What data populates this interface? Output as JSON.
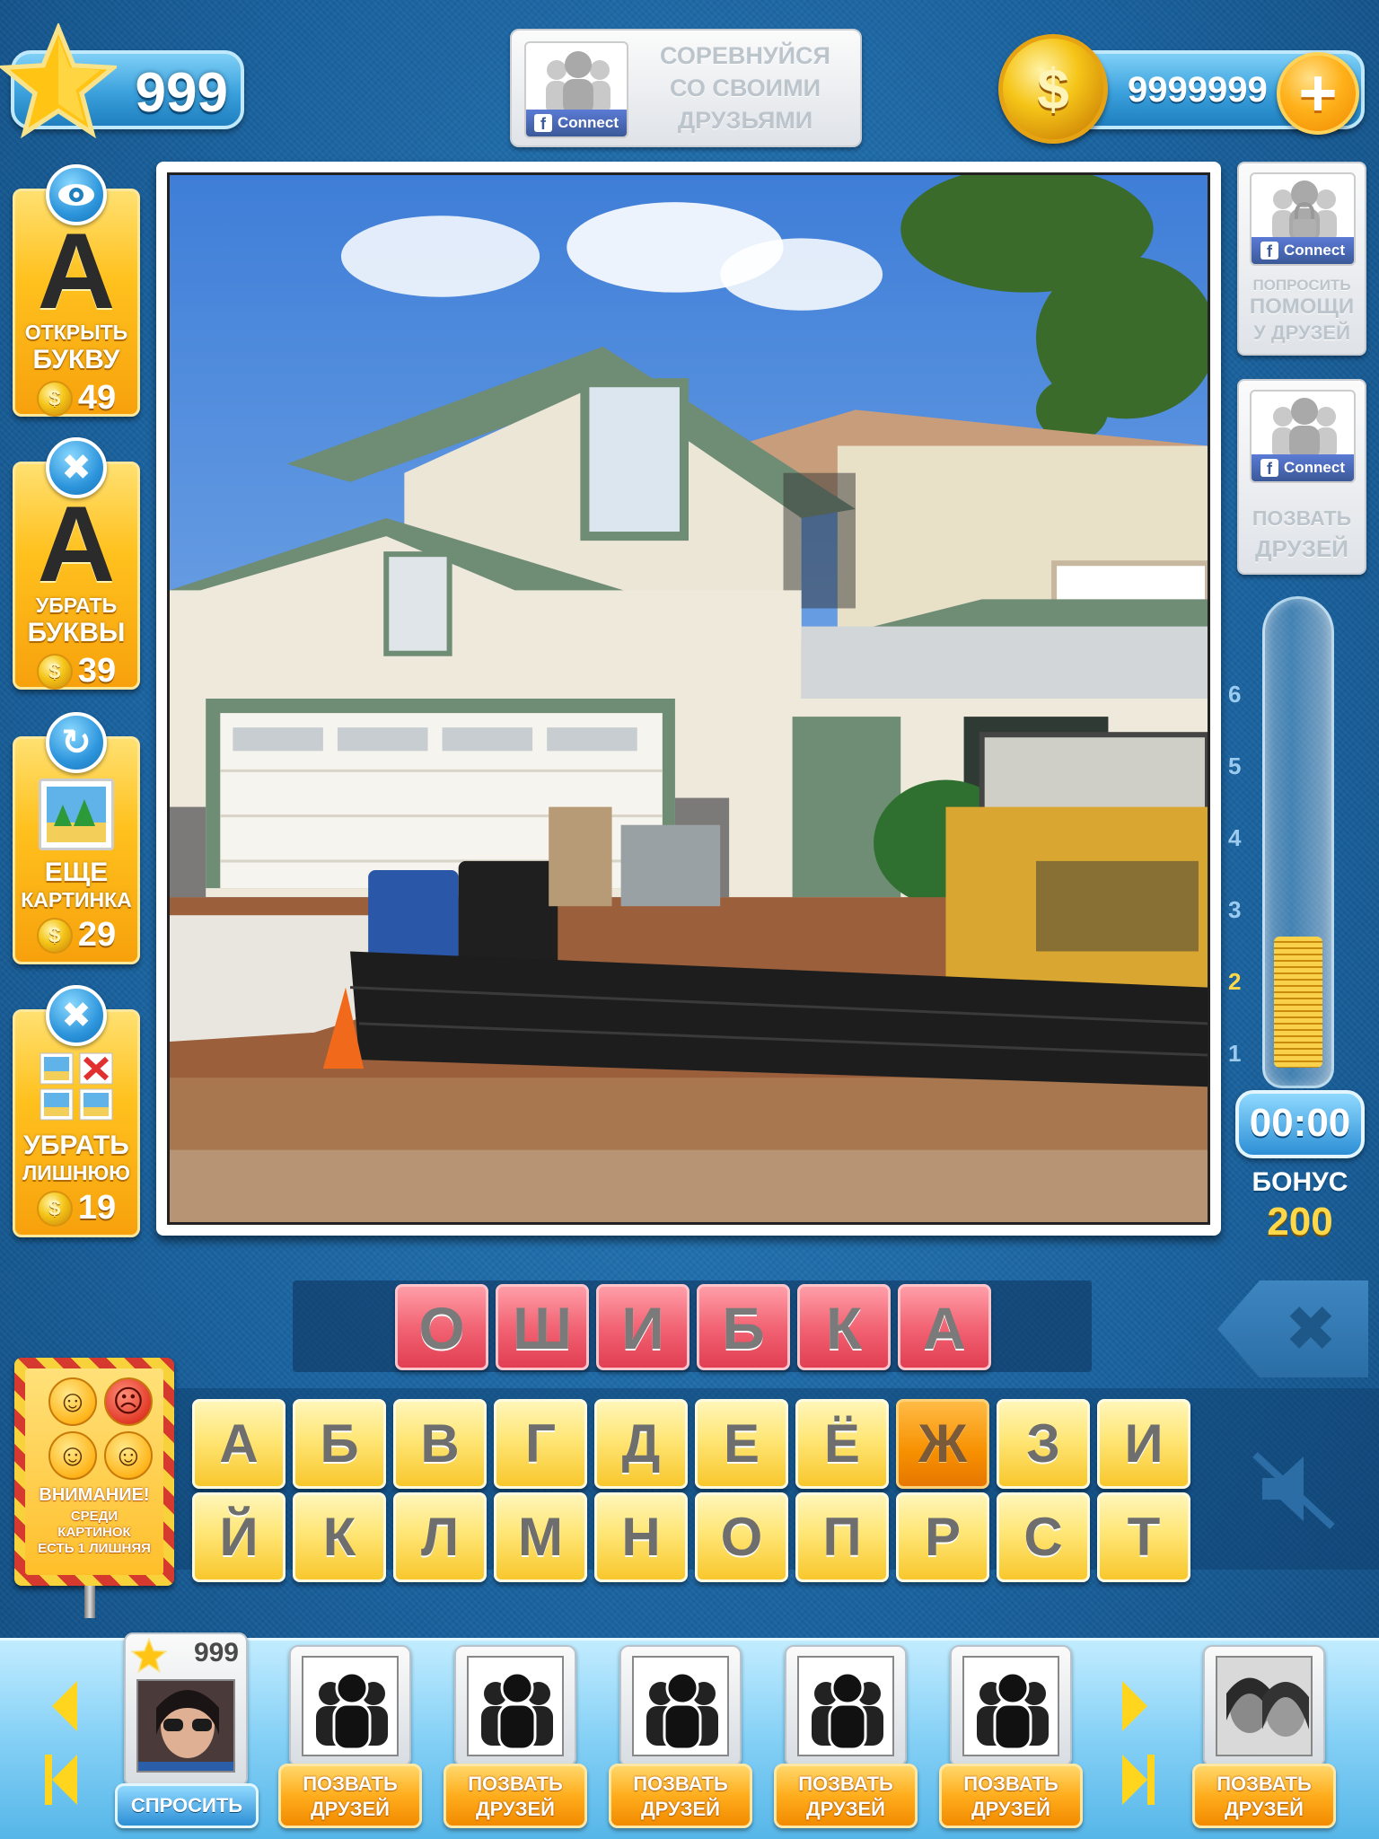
{
  "top": {
    "stars": "999",
    "facebook_banner": {
      "connect_label": "Connect",
      "text": [
        "СОРЕВНУЙСЯ",
        "СО СВОИМИ",
        "ДРУЗЬЯМИ"
      ]
    },
    "coins": "9999999",
    "plus_label": "+"
  },
  "hints": [
    {
      "badge_icon": "eye-icon",
      "letter": "А",
      "label1": "ОТКРЫТЬ",
      "label2": "БУКВУ",
      "cost": "49"
    },
    {
      "badge_icon": "close-icon",
      "letter": "А",
      "label1": "УБРАТЬ",
      "label2": "БУКВЫ",
      "cost": "39"
    },
    {
      "badge_icon": "refresh-icon",
      "label1": "ЕЩЕ",
      "label2": "КАРТИНКА",
      "cost": "29"
    },
    {
      "badge_icon": "close-icon",
      "label1": "УБРАТЬ",
      "label2": "ЛИШНЮЮ",
      "cost": "19"
    }
  ],
  "right_panel": {
    "ask_help": {
      "connect_label": "Connect",
      "text": [
        "ПОПРОСИТЬ",
        "ПОМОЩИ",
        "У ДРУЗЕЙ"
      ]
    },
    "invite": {
      "connect_label": "Connect",
      "text": [
        "ПОЗВАТЬ",
        "ДРУЗЕЙ"
      ]
    },
    "bonus_scale": [
      "6",
      "5",
      "4",
      "3",
      "2",
      "1"
    ],
    "bonus_level": 2,
    "timer": "00:00",
    "bonus_label": "БОНУС",
    "bonus_value": "200"
  },
  "answer": {
    "letters": [
      "О",
      "Ш",
      "И",
      "Б",
      "К",
      "А"
    ]
  },
  "keyboard": {
    "row1": [
      "А",
      "Б",
      "В",
      "Г",
      "Д",
      "Е",
      "Ё",
      "Ж",
      "З",
      "И"
    ],
    "row2": [
      "Й",
      "К",
      "Л",
      "М",
      "Н",
      "О",
      "П",
      "Р",
      "С",
      "Т"
    ],
    "highlighted": "Ж"
  },
  "warning_sign": {
    "title": "ВНИМАНИЕ!",
    "text": [
      "СРЕДИ",
      "КАРТИНОК",
      "ЕСТЬ 1 ЛИШНЯЯ"
    ]
  },
  "friends_bar": {
    "self": {
      "score": "999",
      "button": "СПРОСИТЬ"
    },
    "slots": [
      {
        "button": [
          "ПОЗВАТЬ",
          "ДРУЗЕЙ"
        ]
      },
      {
        "button": [
          "ПОЗВАТЬ",
          "ДРУЗЕЙ"
        ]
      },
      {
        "button": [
          "ПОЗВАТЬ",
          "ДРУЗЕЙ"
        ]
      },
      {
        "button": [
          "ПОЗВАТЬ",
          "ДРУЗЕЙ"
        ]
      },
      {
        "button": [
          "ПОЗВАТЬ",
          "ДРУЗЕЙ"
        ]
      }
    ],
    "last": {
      "button": [
        "ПОЗВАТЬ",
        "ДРУЗЕЙ"
      ]
    }
  },
  "colors": {
    "background": "#1d6aa7",
    "answer_tile": "#f26474",
    "key_tile": "#ffe676",
    "key_used": "#f79000",
    "accent_gold": "#ffc11e"
  }
}
